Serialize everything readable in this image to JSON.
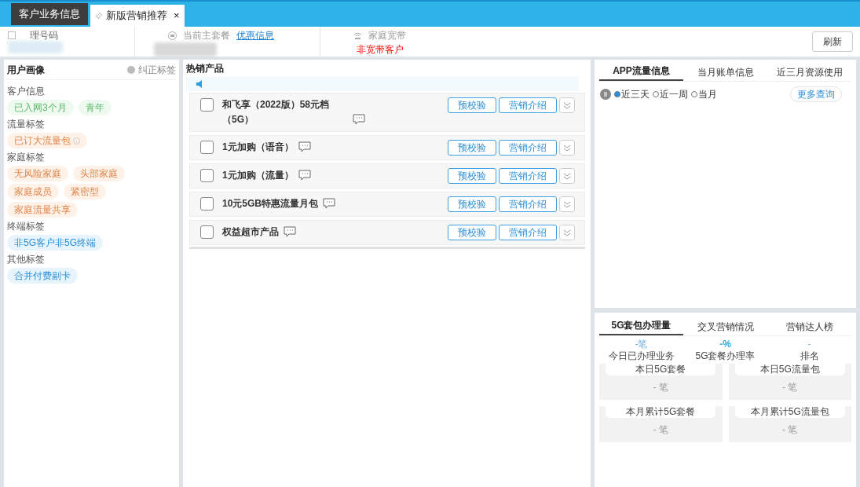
{
  "tabs": [
    {
      "label": "客户业务信息",
      "selected": false,
      "pinned": false,
      "closable": false
    },
    {
      "label": "新版营销推荐",
      "selected": true,
      "pinned": true,
      "closable": true,
      "close": "×"
    }
  ],
  "info_bar": {
    "number_label": "理号码",
    "plan_label": "当前主套餐",
    "plan_link": "优惠信息",
    "broadband_label": "家庭宽带",
    "broadband_value": "非宽带客户",
    "refresh": "刷新"
  },
  "user_profile": {
    "title": "用户画像",
    "correct_link": "纠正标签",
    "groups": [
      {
        "label": "客户信息",
        "tags": [
          {
            "text": "已入网3个月",
            "kind": "green"
          },
          {
            "text": "青年",
            "kind": "green"
          }
        ]
      },
      {
        "label": "流量标签",
        "tags": [
          {
            "text": "已订大流量包",
            "kind": "orange",
            "info": true
          }
        ]
      },
      {
        "label": "家庭标签",
        "tags": [
          {
            "text": "无风险家庭",
            "kind": "orange"
          },
          {
            "text": "头部家庭",
            "kind": "orange"
          },
          {
            "text": "家庭成员",
            "kind": "orange"
          },
          {
            "text": "紧密型",
            "kind": "orange"
          },
          {
            "text": "家庭流量共享",
            "kind": "orange"
          }
        ]
      },
      {
        "label": "终端标签",
        "tags": [
          {
            "text": "非5G客户非5G终端",
            "kind": "blue"
          }
        ]
      },
      {
        "label": "其他标签",
        "tags": [
          {
            "text": "合并付费副卡",
            "kind": "blue"
          }
        ]
      }
    ]
  },
  "hot_products": {
    "title": "热销产品",
    "items": [
      {
        "name": "和飞享（2022版）58元档（5G）",
        "checked": false,
        "precheck": "预校验",
        "intro": "营销介绍"
      },
      {
        "name": "1元加购（语音）",
        "checked": false,
        "precheck": "预校验",
        "intro": "营销介绍"
      },
      {
        "name": "1元加购（流量）",
        "checked": false,
        "precheck": "预校验",
        "intro": "营销介绍"
      },
      {
        "name": "10元5GB特惠流量月包",
        "checked": false,
        "precheck": "预校验",
        "intro": "营销介绍"
      },
      {
        "name": "权益超市产品",
        "checked": false,
        "precheck": "预校验",
        "intro": "营销介绍"
      }
    ]
  },
  "app_panel": {
    "tabs": [
      {
        "label": "APP流量信息",
        "selected": true
      },
      {
        "label": "当月账单信息",
        "selected": false
      },
      {
        "label": "近三月资源使用",
        "selected": false
      }
    ],
    "ranges": [
      {
        "label": "近三天",
        "selected": true
      },
      {
        "label": "近一周",
        "selected": false
      },
      {
        "label": "当月",
        "selected": false
      }
    ],
    "more": "更多查询"
  },
  "stats_panel": {
    "tabs": [
      {
        "label": "5G套包办理量",
        "selected": true
      },
      {
        "label": "交叉营销情况",
        "selected": false
      },
      {
        "label": "营销达人榜",
        "selected": false
      }
    ],
    "summary": [
      {
        "value": "-笔",
        "label": "今日已办理业务",
        "kind": "light"
      },
      {
        "value": "-%",
        "label": "5G套餐办理率",
        "kind": "bold"
      },
      {
        "value": "-",
        "label": "排名",
        "kind": "light"
      }
    ],
    "cards": [
      {
        "title": "本日5G套餐",
        "value": "- 笔"
      },
      {
        "title": "本日5G流量包",
        "value": "- 笔"
      },
      {
        "title": "本月累计5G套餐",
        "value": "- 笔"
      },
      {
        "title": "本月累计5G流量包",
        "value": "- 笔"
      }
    ]
  }
}
